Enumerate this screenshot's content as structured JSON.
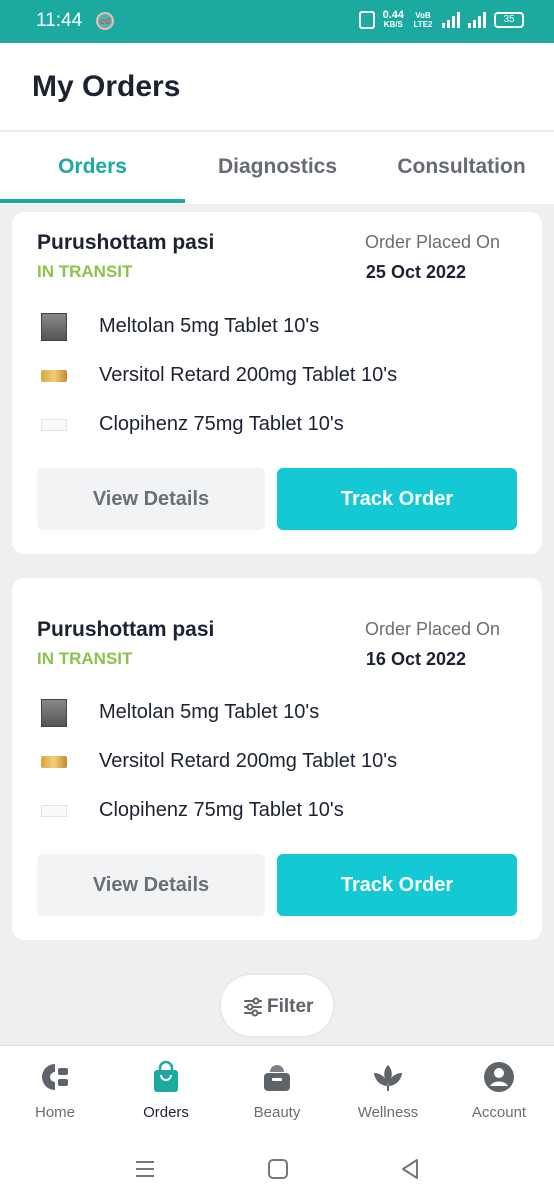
{
  "status_bar": {
    "time": "11:44",
    "speed_value": "0.44",
    "speed_unit": "KB/S",
    "volte": "VoB LTE2",
    "network": "4G",
    "battery": "35"
  },
  "header": {
    "title": "My Orders"
  },
  "tabs": [
    {
      "label": "Orders",
      "active": true
    },
    {
      "label": "Diagnostics",
      "active": false
    },
    {
      "label": "Consultation",
      "active": false
    }
  ],
  "orders": [
    {
      "customer": "Purushottam pasi",
      "status": "IN TRANSIT",
      "placed_label": "Order Placed On",
      "placed_date": "25 Oct 2022",
      "items": [
        {
          "name": "Meltolan 5mg Tablet 10's",
          "thumb": "strip-thumb"
        },
        {
          "name": "Versitol Retard 200mg Tablet 10's",
          "thumb": "box-thumb"
        },
        {
          "name": "Clopihenz 75mg Tablet 10's",
          "thumb": "white-box-thumb"
        }
      ],
      "view_label": "View Details",
      "track_label": "Track Order"
    },
    {
      "customer": "Purushottam pasi",
      "status": "IN TRANSIT",
      "placed_label": "Order Placed On",
      "placed_date": "16 Oct 2022",
      "items": [
        {
          "name": "Meltolan 5mg Tablet 10's",
          "thumb": "strip-thumb"
        },
        {
          "name": "Versitol Retard 200mg Tablet 10's",
          "thumb": "box-thumb"
        },
        {
          "name": "Clopihenz 75mg Tablet 10's",
          "thumb": "white-box-thumb"
        }
      ],
      "view_label": "View Details",
      "track_label": "Track Order"
    }
  ],
  "filter": {
    "label": "Filter",
    "icon": "sliders-icon"
  },
  "bottom_nav": [
    {
      "label": "Home",
      "icon": "home-icon",
      "active": false
    },
    {
      "label": "Orders",
      "icon": "shopping-bag-icon",
      "active": true
    },
    {
      "label": "Beauty",
      "icon": "beauty-icon",
      "active": false
    },
    {
      "label": "Wellness",
      "icon": "lotus-icon",
      "active": false
    },
    {
      "label": "Account",
      "icon": "account-icon",
      "active": false
    }
  ],
  "colors": {
    "primary": "#1ba9a0",
    "track_button": "#14c8d4",
    "status_green": "#8bc34a"
  }
}
